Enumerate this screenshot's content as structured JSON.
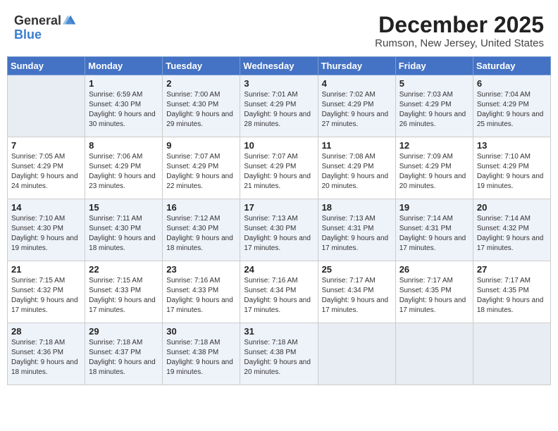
{
  "header": {
    "logo_general": "General",
    "logo_blue": "Blue",
    "month": "December 2025",
    "location": "Rumson, New Jersey, United States"
  },
  "days_of_week": [
    "Sunday",
    "Monday",
    "Tuesday",
    "Wednesday",
    "Thursday",
    "Friday",
    "Saturday"
  ],
  "weeks": [
    [
      {
        "day": "",
        "empty": true
      },
      {
        "day": "1",
        "sunrise": "Sunrise: 6:59 AM",
        "sunset": "Sunset: 4:30 PM",
        "daylight": "Daylight: 9 hours and 30 minutes."
      },
      {
        "day": "2",
        "sunrise": "Sunrise: 7:00 AM",
        "sunset": "Sunset: 4:30 PM",
        "daylight": "Daylight: 9 hours and 29 minutes."
      },
      {
        "day": "3",
        "sunrise": "Sunrise: 7:01 AM",
        "sunset": "Sunset: 4:29 PM",
        "daylight": "Daylight: 9 hours and 28 minutes."
      },
      {
        "day": "4",
        "sunrise": "Sunrise: 7:02 AM",
        "sunset": "Sunset: 4:29 PM",
        "daylight": "Daylight: 9 hours and 27 minutes."
      },
      {
        "day": "5",
        "sunrise": "Sunrise: 7:03 AM",
        "sunset": "Sunset: 4:29 PM",
        "daylight": "Daylight: 9 hours and 26 minutes."
      },
      {
        "day": "6",
        "sunrise": "Sunrise: 7:04 AM",
        "sunset": "Sunset: 4:29 PM",
        "daylight": "Daylight: 9 hours and 25 minutes."
      }
    ],
    [
      {
        "day": "7",
        "sunrise": "Sunrise: 7:05 AM",
        "sunset": "Sunset: 4:29 PM",
        "daylight": "Daylight: 9 hours and 24 minutes."
      },
      {
        "day": "8",
        "sunrise": "Sunrise: 7:06 AM",
        "sunset": "Sunset: 4:29 PM",
        "daylight": "Daylight: 9 hours and 23 minutes."
      },
      {
        "day": "9",
        "sunrise": "Sunrise: 7:07 AM",
        "sunset": "Sunset: 4:29 PM",
        "daylight": "Daylight: 9 hours and 22 minutes."
      },
      {
        "day": "10",
        "sunrise": "Sunrise: 7:07 AM",
        "sunset": "Sunset: 4:29 PM",
        "daylight": "Daylight: 9 hours and 21 minutes."
      },
      {
        "day": "11",
        "sunrise": "Sunrise: 7:08 AM",
        "sunset": "Sunset: 4:29 PM",
        "daylight": "Daylight: 9 hours and 20 minutes."
      },
      {
        "day": "12",
        "sunrise": "Sunrise: 7:09 AM",
        "sunset": "Sunset: 4:29 PM",
        "daylight": "Daylight: 9 hours and 20 minutes."
      },
      {
        "day": "13",
        "sunrise": "Sunrise: 7:10 AM",
        "sunset": "Sunset: 4:29 PM",
        "daylight": "Daylight: 9 hours and 19 minutes."
      }
    ],
    [
      {
        "day": "14",
        "sunrise": "Sunrise: 7:10 AM",
        "sunset": "Sunset: 4:30 PM",
        "daylight": "Daylight: 9 hours and 19 minutes."
      },
      {
        "day": "15",
        "sunrise": "Sunrise: 7:11 AM",
        "sunset": "Sunset: 4:30 PM",
        "daylight": "Daylight: 9 hours and 18 minutes."
      },
      {
        "day": "16",
        "sunrise": "Sunrise: 7:12 AM",
        "sunset": "Sunset: 4:30 PM",
        "daylight": "Daylight: 9 hours and 18 minutes."
      },
      {
        "day": "17",
        "sunrise": "Sunrise: 7:13 AM",
        "sunset": "Sunset: 4:30 PM",
        "daylight": "Daylight: 9 hours and 17 minutes."
      },
      {
        "day": "18",
        "sunrise": "Sunrise: 7:13 AM",
        "sunset": "Sunset: 4:31 PM",
        "daylight": "Daylight: 9 hours and 17 minutes."
      },
      {
        "day": "19",
        "sunrise": "Sunrise: 7:14 AM",
        "sunset": "Sunset: 4:31 PM",
        "daylight": "Daylight: 9 hours and 17 minutes."
      },
      {
        "day": "20",
        "sunrise": "Sunrise: 7:14 AM",
        "sunset": "Sunset: 4:32 PM",
        "daylight": "Daylight: 9 hours and 17 minutes."
      }
    ],
    [
      {
        "day": "21",
        "sunrise": "Sunrise: 7:15 AM",
        "sunset": "Sunset: 4:32 PM",
        "daylight": "Daylight: 9 hours and 17 minutes."
      },
      {
        "day": "22",
        "sunrise": "Sunrise: 7:15 AM",
        "sunset": "Sunset: 4:33 PM",
        "daylight": "Daylight: 9 hours and 17 minutes."
      },
      {
        "day": "23",
        "sunrise": "Sunrise: 7:16 AM",
        "sunset": "Sunset: 4:33 PM",
        "daylight": "Daylight: 9 hours and 17 minutes."
      },
      {
        "day": "24",
        "sunrise": "Sunrise: 7:16 AM",
        "sunset": "Sunset: 4:34 PM",
        "daylight": "Daylight: 9 hours and 17 minutes."
      },
      {
        "day": "25",
        "sunrise": "Sunrise: 7:17 AM",
        "sunset": "Sunset: 4:34 PM",
        "daylight": "Daylight: 9 hours and 17 minutes."
      },
      {
        "day": "26",
        "sunrise": "Sunrise: 7:17 AM",
        "sunset": "Sunset: 4:35 PM",
        "daylight": "Daylight: 9 hours and 17 minutes."
      },
      {
        "day": "27",
        "sunrise": "Sunrise: 7:17 AM",
        "sunset": "Sunset: 4:35 PM",
        "daylight": "Daylight: 9 hours and 18 minutes."
      }
    ],
    [
      {
        "day": "28",
        "sunrise": "Sunrise: 7:18 AM",
        "sunset": "Sunset: 4:36 PM",
        "daylight": "Daylight: 9 hours and 18 minutes."
      },
      {
        "day": "29",
        "sunrise": "Sunrise: 7:18 AM",
        "sunset": "Sunset: 4:37 PM",
        "daylight": "Daylight: 9 hours and 18 minutes."
      },
      {
        "day": "30",
        "sunrise": "Sunrise: 7:18 AM",
        "sunset": "Sunset: 4:38 PM",
        "daylight": "Daylight: 9 hours and 19 minutes."
      },
      {
        "day": "31",
        "sunrise": "Sunrise: 7:18 AM",
        "sunset": "Sunset: 4:38 PM",
        "daylight": "Daylight: 9 hours and 20 minutes."
      },
      {
        "day": "",
        "empty": true
      },
      {
        "day": "",
        "empty": true
      },
      {
        "day": "",
        "empty": true
      }
    ]
  ]
}
